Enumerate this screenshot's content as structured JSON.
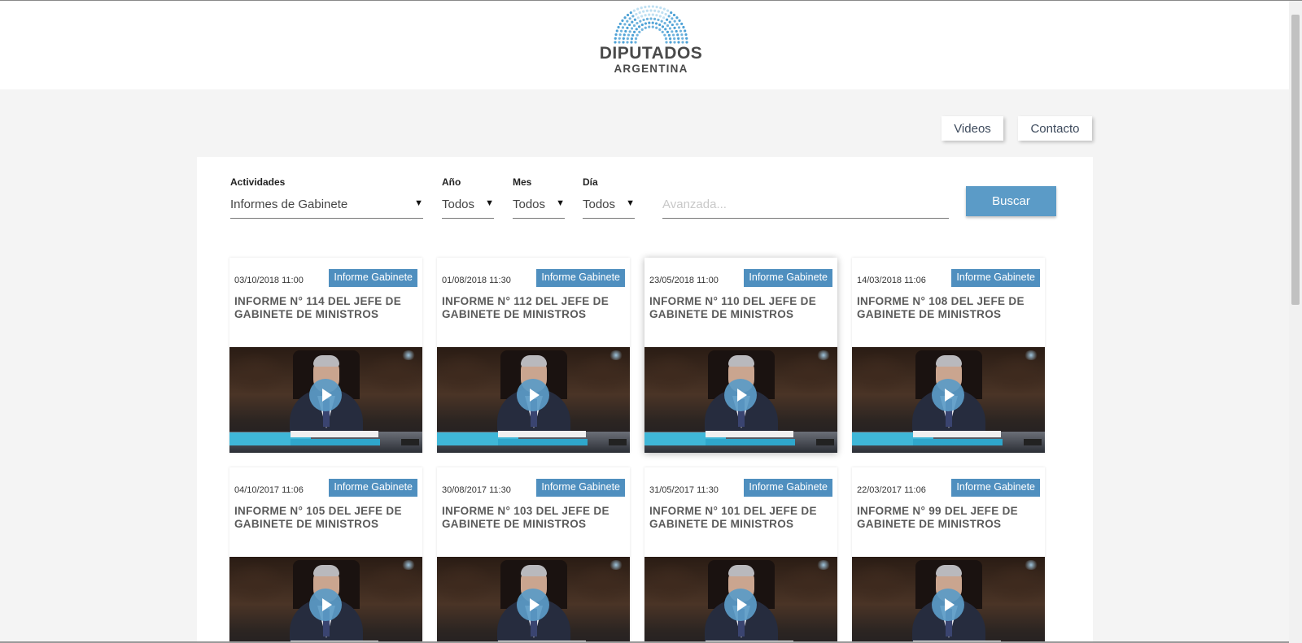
{
  "header": {
    "logo_line1": "DIPUTADOS",
    "logo_line2": "ARGENTINA"
  },
  "nav": {
    "videos": "Videos",
    "contacto": "Contacto"
  },
  "filters": {
    "actividades_label": "Actividades",
    "actividades_value": "Informes de Gabinete",
    "anio_label": "Año",
    "anio_value": "Todos",
    "mes_label": "Mes",
    "mes_value": "Todos",
    "dia_label": "Día",
    "dia_value": "Todos",
    "avanzada_placeholder": "Avanzada...",
    "buscar_label": "Buscar"
  },
  "colors": {
    "accent": "#5b9bc7",
    "badge": "#4f8fbf"
  },
  "videos": [
    {
      "date": "03/10/2018 11:00",
      "badge": "Informe Gabinete",
      "title": "INFORME N° 114 DEL JEFE DE GABINETE DE MINISTROS"
    },
    {
      "date": "01/08/2018 11:30",
      "badge": "Informe Gabinete",
      "title": "INFORME N° 112 DEL JEFE DE GABINETE DE MINISTROS"
    },
    {
      "date": "23/05/2018 11:00",
      "badge": "Informe Gabinete",
      "title": "INFORME N° 110 DEL JEFE DE GABINETE DE MINISTROS"
    },
    {
      "date": "14/03/2018 11:06",
      "badge": "Informe Gabinete",
      "title": "INFORME N° 108 DEL JEFE DE GABINETE DE MINISTROS"
    },
    {
      "date": "04/10/2017 11:06",
      "badge": "Informe Gabinete",
      "title": "INFORME N° 105 DEL JEFE DE GABINETE DE MINISTROS"
    },
    {
      "date": "30/08/2017 11:30",
      "badge": "Informe Gabinete",
      "title": "INFORME N° 103 DEL JEFE DE GABINETE DE MINISTROS"
    },
    {
      "date": "31/05/2017 11:30",
      "badge": "Informe Gabinete",
      "title": "INFORME N° 101 DEL JEFE DE GABINETE DE MINISTROS"
    },
    {
      "date": "22/03/2017 11:06",
      "badge": "Informe Gabinete",
      "title": "INFORME N° 99 DEL JEFE DE GABINETE DE MINISTROS"
    }
  ]
}
